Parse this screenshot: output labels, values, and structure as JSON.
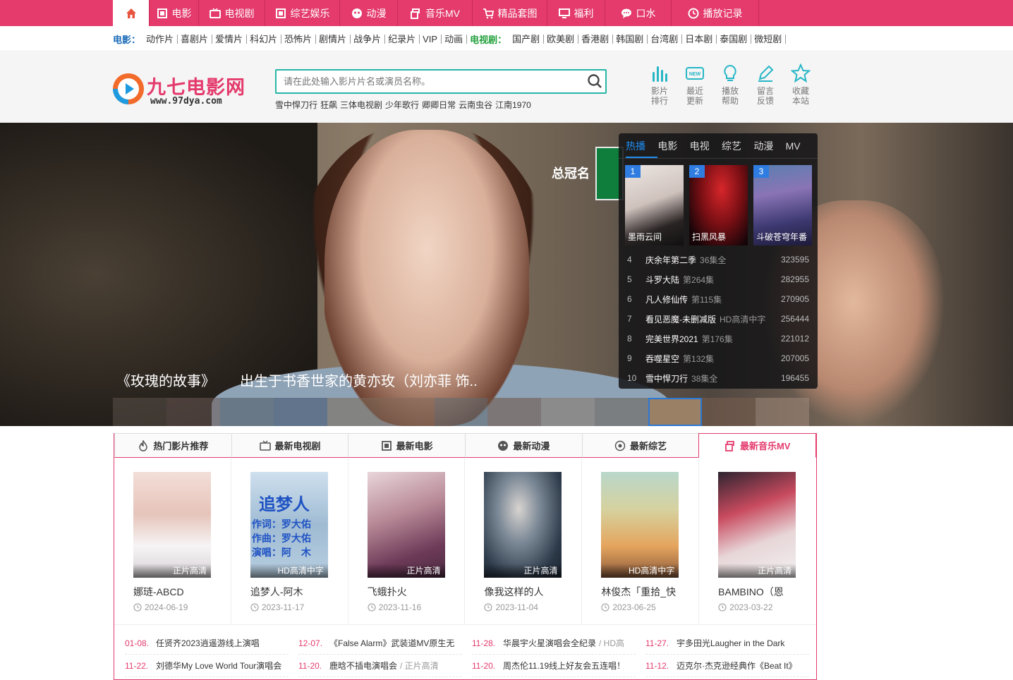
{
  "topnav": {
    "items": [
      {
        "label": "电影",
        "icon": "film-icon"
      },
      {
        "label": "电视剧",
        "icon": "tv-icon"
      },
      {
        "label": "综艺娱乐",
        "icon": "film-icon"
      },
      {
        "label": "动漫",
        "icon": "mask-icon"
      },
      {
        "label": "音乐MV",
        "icon": "music-icon"
      },
      {
        "label": "精品套图",
        "icon": "cart-icon"
      },
      {
        "label": "福利",
        "icon": "monitor-icon"
      },
      {
        "label": "口水",
        "icon": "chat-icon"
      },
      {
        "label": "播放记录",
        "icon": "clock-icon"
      }
    ]
  },
  "subnav": {
    "movie_label": "电影：",
    "movie_links": [
      "动作片",
      "喜剧片",
      "爱情片",
      "科幻片",
      "恐怖片",
      "剧情片",
      "战争片",
      "纪录片",
      "VIP",
      "动画"
    ],
    "tv_label": "电视剧：",
    "tv_links": [
      "国产剧",
      "欧美剧",
      "香港剧",
      "韩国剧",
      "台湾剧",
      "日本剧",
      "泰国剧",
      "微短剧"
    ]
  },
  "header": {
    "logo_text": "九七电影网",
    "logo_url": "www.97dya.com",
    "search_placeholder": "请在此处输入影片片名或演员名称。",
    "hotwords": [
      "雪中悍刀行",
      "狂飙",
      "三体电视剧",
      "少年歌行",
      "卿卿日常",
      "云南虫谷",
      "江南1970"
    ],
    "tools": [
      {
        "line1": "影片",
        "line2": "排行"
      },
      {
        "line1": "最近",
        "line2": "更新"
      },
      {
        "line1": "播放",
        "line2": "帮助"
      },
      {
        "line1": "留言",
        "line2": "反馈"
      },
      {
        "line1": "收藏",
        "line2": "本站"
      }
    ]
  },
  "banner": {
    "title": "《玫瑰的故事》",
    "desc": "出生于书香世家的黄亦玫（刘亦菲 饰..",
    "sign_text": "总冠名"
  },
  "hot": {
    "tabs": [
      "热播",
      "电影",
      "电视",
      "综艺",
      "动漫",
      "MV"
    ],
    "posters": [
      {
        "num": "1",
        "title": "墨雨云间"
      },
      {
        "num": "2",
        "title": "扫黑风暴"
      },
      {
        "num": "3",
        "title": "斗破苍穹年番"
      }
    ],
    "list": [
      {
        "rank": "4",
        "title": "庆余年第二季",
        "ep": "36集全",
        "count": "323595"
      },
      {
        "rank": "5",
        "title": "斗罗大陆",
        "ep": "第264集",
        "count": "282955"
      },
      {
        "rank": "6",
        "title": "凡人修仙传",
        "ep": "第115集",
        "count": "270905"
      },
      {
        "rank": "7",
        "title": "看见恶魔-未删减版",
        "ep": "HD高清中字",
        "count": "256444"
      },
      {
        "rank": "8",
        "title": "完美世界2021",
        "ep": "第176集",
        "count": "221012"
      },
      {
        "rank": "9",
        "title": "吞噬星空",
        "ep": "第132集",
        "count": "207005"
      },
      {
        "rank": "10",
        "title": "雪中悍刀行",
        "ep": "38集全",
        "count": "196455"
      }
    ]
  },
  "section": {
    "tabs": [
      {
        "label": "热门影片推荐",
        "icon": "flame-icon"
      },
      {
        "label": "最新电视剧",
        "icon": "tv-icon"
      },
      {
        "label": "最新电影",
        "icon": "film-icon"
      },
      {
        "label": "最新动漫",
        "icon": "mask-icon"
      },
      {
        "label": "最新综艺",
        "icon": "target-icon"
      },
      {
        "label": "最新音乐MV",
        "icon": "music-icon"
      }
    ],
    "cards": [
      {
        "title": "娜琏-ABCD",
        "date": "2024-06-19",
        "badge": "正片高清"
      },
      {
        "title": "追梦人-阿木",
        "date": "2023-11-17",
        "badge": "HD高清中字"
      },
      {
        "title": "飞蛾扑火",
        "date": "2023-11-16",
        "badge": "正片高清"
      },
      {
        "title": "像我这样的人",
        "date": "2023-11-04",
        "badge": "正片高清"
      },
      {
        "title": "林俊杰「重拾_快",
        "date": "2023-06-25",
        "badge": "HD高清中字"
      },
      {
        "title": "BAMBINO（恩",
        "date": "2023-03-22",
        "badge": "正片高清"
      }
    ],
    "poster2_text": [
      "追梦人",
      "作词：罗大佑",
      "作曲：罗大佑",
      "演唱：阿　木"
    ],
    "list": [
      {
        "date": "01-08.",
        "title": "任贤齐2023逍遥游线上演唱",
        "quality": ""
      },
      {
        "date": "12-07.",
        "title": "《False Alarm》武装道MV原生无",
        "quality": ""
      },
      {
        "date": "11-28.",
        "title": "华晨宇火星演唱会全纪录",
        "quality": "/ HD高"
      },
      {
        "date": "11-27.",
        "title": "宇多田光Laugher in the Dark",
        "quality": ""
      },
      {
        "date": "11-22.",
        "title": "刘德华My Love World Tour演唱会",
        "quality": ""
      },
      {
        "date": "11-20.",
        "title": "鹿晗不插电演唱会",
        "quality": "/ 正片高清"
      },
      {
        "date": "11-20.",
        "title": "周杰伦11.19线上好友会五连唱！",
        "quality": ""
      },
      {
        "date": "11-12.",
        "title": "迈克尔·杰克逊经典作《Beat It》",
        "quality": ""
      }
    ]
  },
  "colors": {
    "brand": "#e43a6c",
    "search_border": "#26b6a6",
    "accent_blue": "#1f8ef1"
  }
}
